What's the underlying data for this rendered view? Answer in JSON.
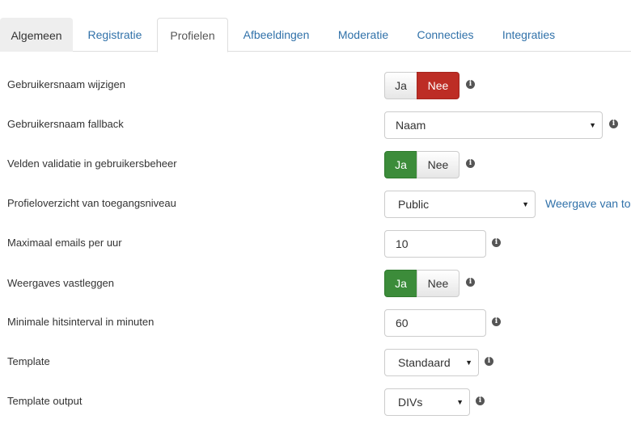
{
  "tabs": [
    {
      "label": "Algemeen"
    },
    {
      "label": "Registratie"
    },
    {
      "label": "Profielen"
    },
    {
      "label": "Afbeeldingen"
    },
    {
      "label": "Moderatie"
    },
    {
      "label": "Connecties"
    },
    {
      "label": "Integraties"
    }
  ],
  "active_tab": "Profielen",
  "rows": {
    "username_change": {
      "label": "Gebruikersnaam wijzigen",
      "yes": "Ja",
      "no": "Nee",
      "selected": "Nee"
    },
    "username_fallback": {
      "label": "Gebruikersnaam fallback",
      "value": "Naam"
    },
    "field_validation": {
      "label": "Velden validatie in gebruikersbeheer",
      "yes": "Ja",
      "no": "Nee",
      "selected": "Ja"
    },
    "profile_overview": {
      "label": "Profieloverzicht van toegangsniveau",
      "value": "Public",
      "link": "Weergave van to"
    },
    "max_emails": {
      "label": "Maximaal emails per uur",
      "value": "10"
    },
    "log_views": {
      "label": "Weergaves vastleggen",
      "yes": "Ja",
      "no": "Nee",
      "selected": "Ja"
    },
    "min_hits": {
      "label": "Minimale hitsinterval in minuten",
      "value": "60"
    },
    "template": {
      "label": "Template",
      "value": "Standaard"
    },
    "template_output": {
      "label": "Template output",
      "value": "DIVs"
    }
  },
  "colors": {
    "link": "#3071a9",
    "danger": "#bd2d25",
    "success": "#3c8c3a",
    "tab_inactive_bg": "#eeeeee",
    "border": "#cccccc"
  },
  "icons": {
    "info": "info-icon",
    "caret": "caret-down-icon"
  }
}
